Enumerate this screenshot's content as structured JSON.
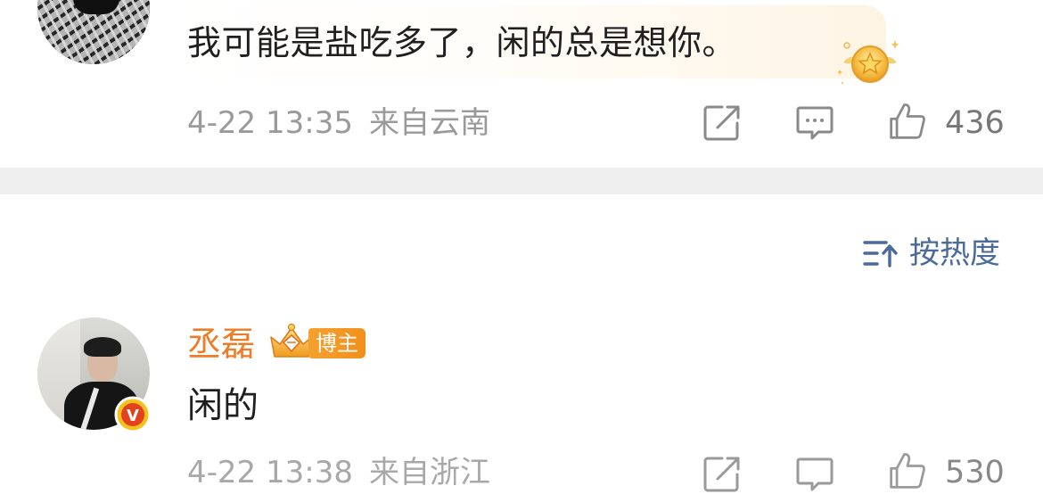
{
  "comment_top": {
    "text": "我可能是盐吃多了，闲的总是想你。",
    "timestamp": "4-22 13:35",
    "location": "来自云南",
    "like_count": "436",
    "avatar": "avatar",
    "badge_icon": "gold-star-badge-icon"
  },
  "sort": {
    "label": "按热度",
    "icon": "sort-lines-up-icon"
  },
  "comment_bottom": {
    "username": "丞磊",
    "role_tag": "博主",
    "text": "闲的",
    "timestamp": "4-22 13:38",
    "location": "来自浙江",
    "like_count": "530",
    "verified_badge_label": "V",
    "crown_icon": "crown-icon"
  },
  "colors": {
    "username": "#ef7b24",
    "sort_text": "#4a6a9a",
    "meta_text": "#9a9a9a",
    "divider": "#efefef",
    "tag_bg": "#f5a12e",
    "verified_bg": "#f4c11e"
  },
  "icons": {
    "share": "share-icon",
    "reply": "comment-icon",
    "like": "thumbs-up-icon"
  }
}
